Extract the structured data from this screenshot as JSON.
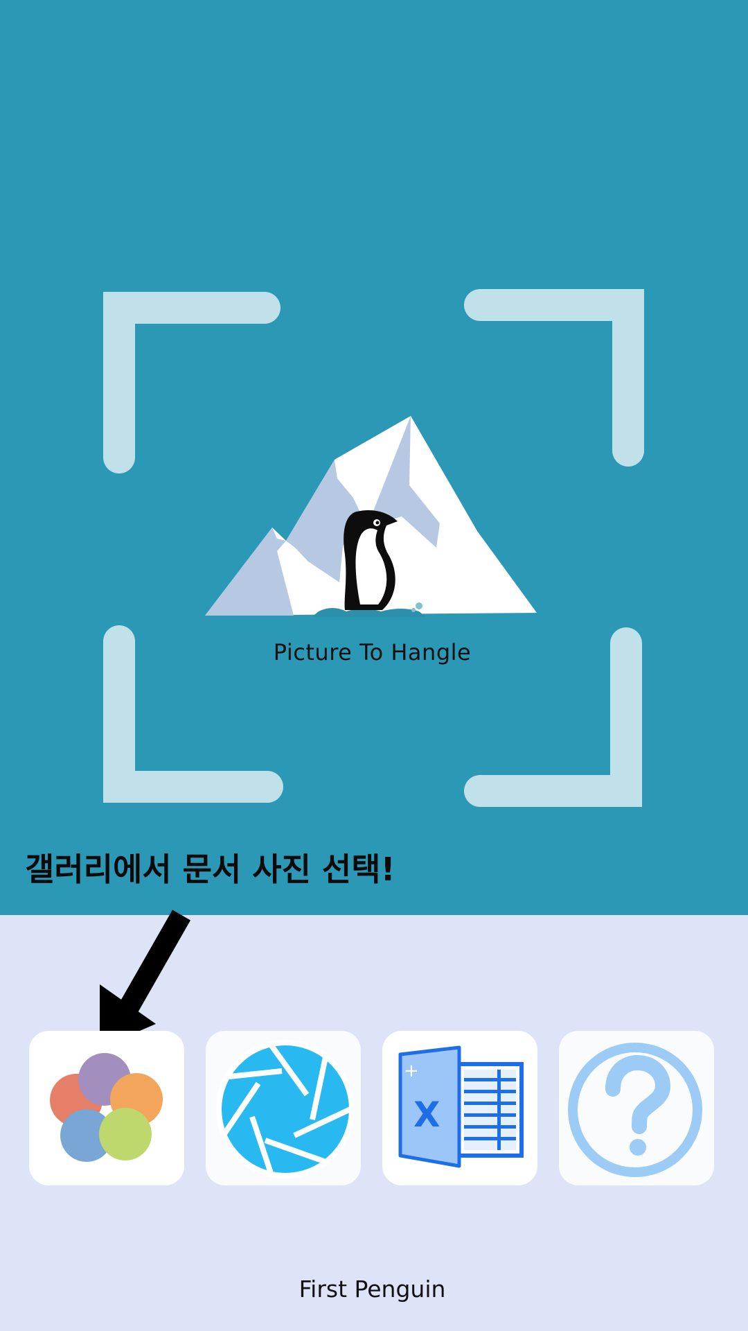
{
  "app": {
    "title": "Picture To Hangle"
  },
  "hint": {
    "text": "갤러리에서 문서 사진 선택!"
  },
  "buttons": [
    {
      "icon": "gallery-icon"
    },
    {
      "icon": "camera-shutter-icon"
    },
    {
      "icon": "excel-icon"
    },
    {
      "icon": "help-icon"
    }
  ],
  "footer": {
    "text": "First Penguin"
  },
  "colors": {
    "top_background": "#2b98b6",
    "bottom_background": "#dde4f7",
    "frame_corners": "#c1e1ea",
    "camera_icon": "#29b9f1",
    "excel_icon": "#1e6ee8",
    "help_icon": "#9ccbf6"
  }
}
